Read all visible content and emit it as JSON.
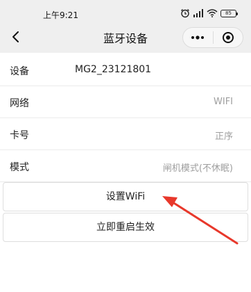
{
  "status_bar": {
    "time": "上午9:21",
    "battery": "85"
  },
  "nav": {
    "title": "蓝牙设备"
  },
  "rows": [
    {
      "label": "设备",
      "value": "MG2_23121801"
    },
    {
      "label": "网络",
      "value": "WIFI"
    },
    {
      "label": "卡号",
      "value": "正序"
    },
    {
      "label": "模式",
      "value": "闸机模式(不休眠)"
    }
  ],
  "buttons": {
    "set_wifi": "设置WiFi",
    "restart": "立即重启生效"
  },
  "colors": {
    "header_bg": "#efefef",
    "value_gray": "#9e9e9e",
    "arrow_red": "#e8382b"
  }
}
